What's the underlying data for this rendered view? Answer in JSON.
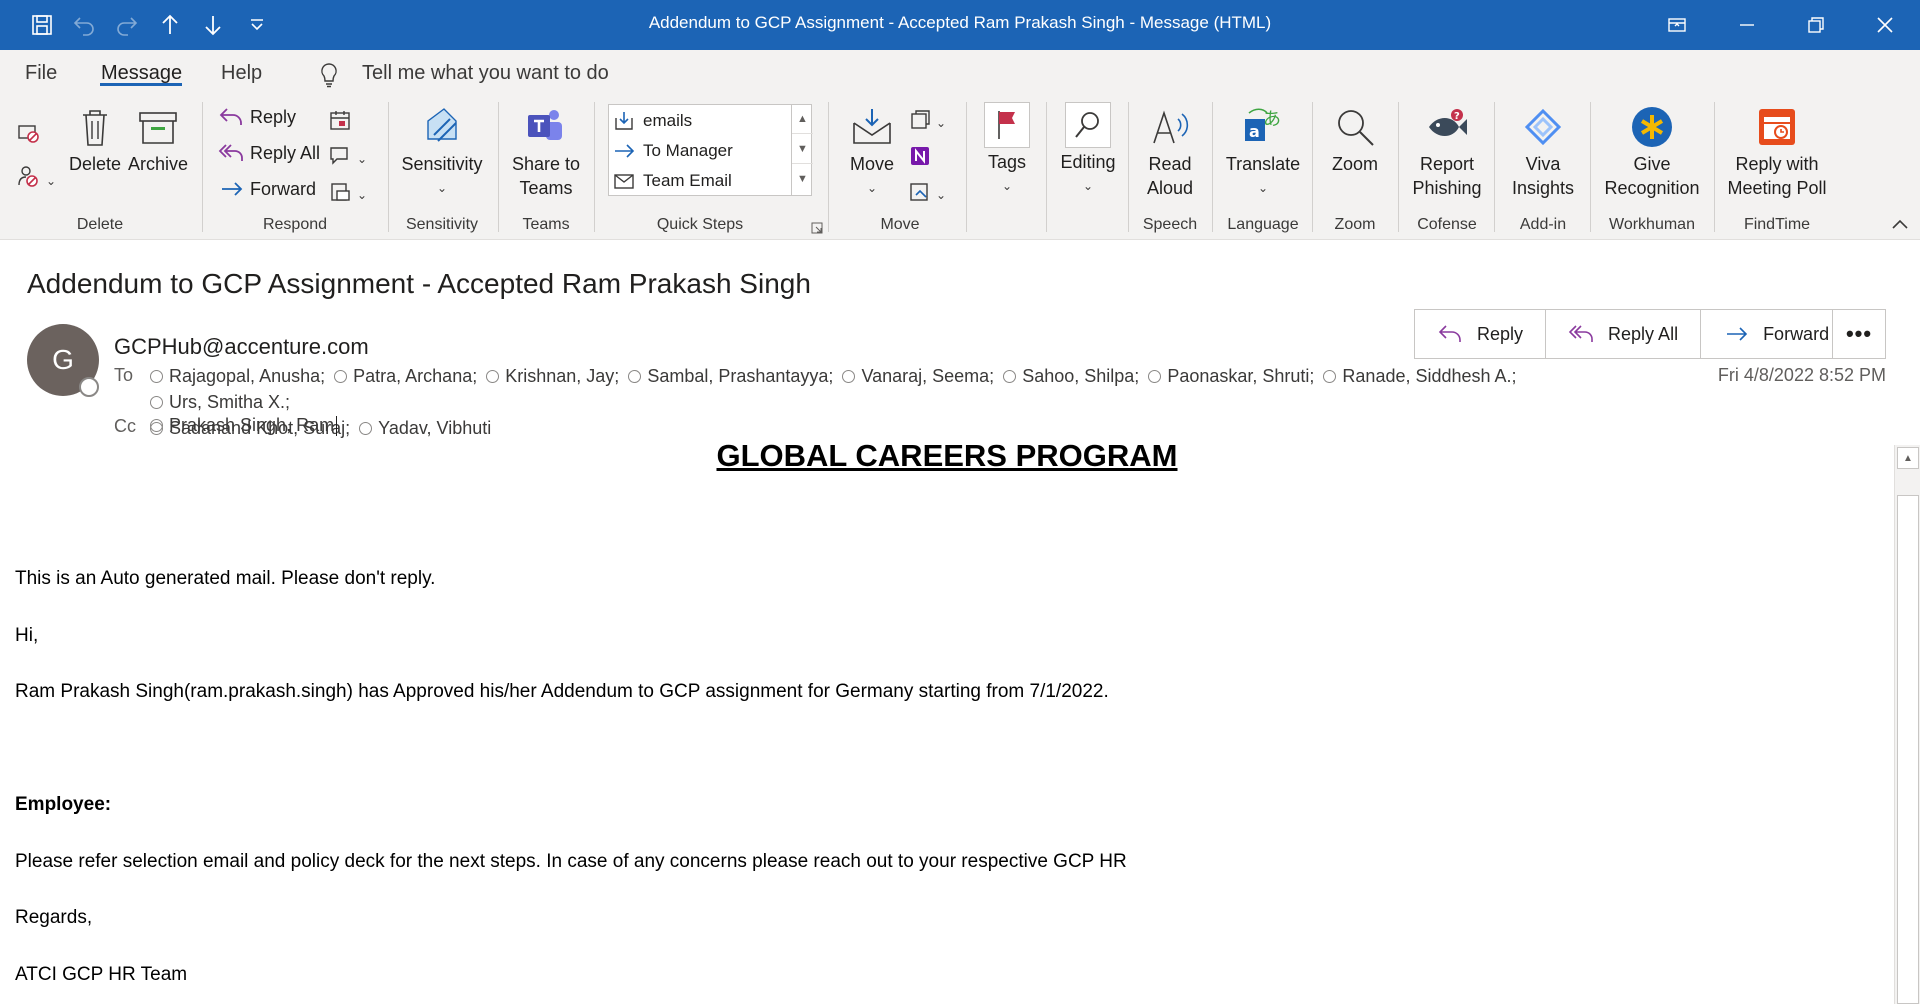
{
  "window": {
    "title": "Addendum to GCP Assignment - Accepted Ram Prakash Singh  -  Message (HTML)"
  },
  "menu": {
    "tabs": [
      "File",
      "Message",
      "Help"
    ],
    "active_tab": "Message",
    "tell_me": "Tell me what you want to do"
  },
  "ribbon": {
    "delete_group": {
      "label": "Delete",
      "delete": "Delete",
      "archive": "Archive"
    },
    "respond_group": {
      "label": "Respond",
      "reply": "Reply",
      "reply_all": "Reply All",
      "forward": "Forward"
    },
    "sensitivity_group": {
      "label": "Sensitivity",
      "sensitivity": "Sensitivity"
    },
    "teams_group": {
      "label": "Teams",
      "share": "Share to Teams"
    },
    "quick_steps_group": {
      "label": "Quick Steps",
      "items": [
        "emails",
        "To Manager",
        "Team Email"
      ]
    },
    "move_group": {
      "label": "Move",
      "move": "Move"
    },
    "tags": "Tags",
    "editing": "Editing",
    "speech_group": {
      "label": "Speech",
      "read_aloud": "Read Aloud"
    },
    "language_group": {
      "label": "Language",
      "translate": "Translate"
    },
    "zoom_group": {
      "label": "Zoom",
      "zoom": "Zoom"
    },
    "cofense_group": {
      "label": "Cofense",
      "report_phishing": "Report Phishing"
    },
    "addin_group": {
      "label": "Add-in",
      "viva": "Viva Insights"
    },
    "workhuman_group": {
      "label": "Workhuman",
      "give_recognition": "Give Recognition"
    },
    "findtime_group": {
      "label": "FindTime",
      "reply_poll": "Reply with Meeting Poll"
    }
  },
  "message": {
    "subject": "Addendum to GCP Assignment - Accepted Ram Prakash Singh",
    "avatar_initial": "G",
    "sender": "GCPHub@accenture.com",
    "to_label": "To",
    "to": [
      "Rajagopal, Anusha;",
      "Patra, Archana;",
      "Krishnan, Jay;",
      "Sambal, Prashantayya;",
      "Vanaraj, Seema;",
      "Sahoo, Shilpa;",
      "Paonaskar, Shruti;",
      "Ranade, Siddhesh A.;",
      "Urs, Smitha X.;",
      "Sadanand Khot, Suraj;",
      "Yadav, Vibhuti"
    ],
    "cc_label": "Cc",
    "cc": "Prakash Singh, Ram",
    "datetime": "Fri 4/8/2022 8:52 PM",
    "actions": {
      "reply": "Reply",
      "reply_all": "Reply All",
      "forward": "Forward",
      "more": "•••"
    }
  },
  "body": {
    "heading": "GLOBAL CAREERS PROGRAM",
    "auto_note": "This is an Auto generated mail. Please don't reply.",
    "greeting": "Hi,",
    "approval": " Ram Prakash Singh(ram.prakash.singh) has Approved his/her Addendum to GCP assignment for Germany starting from 7/1/2022.",
    "employee_label": "Employee:",
    "refer": "Please refer selection email and policy deck for the next steps. In case of any concerns please reach out to your respective GCP HR",
    "regards": "Regards,",
    "signature": "ATCI GCP HR Team"
  },
  "colors": {
    "accent": "#1c64b5",
    "ribbon_bg": "#f3f2f1",
    "reply_purple": "#8a3a9e",
    "forward_blue": "#1c64b5"
  }
}
